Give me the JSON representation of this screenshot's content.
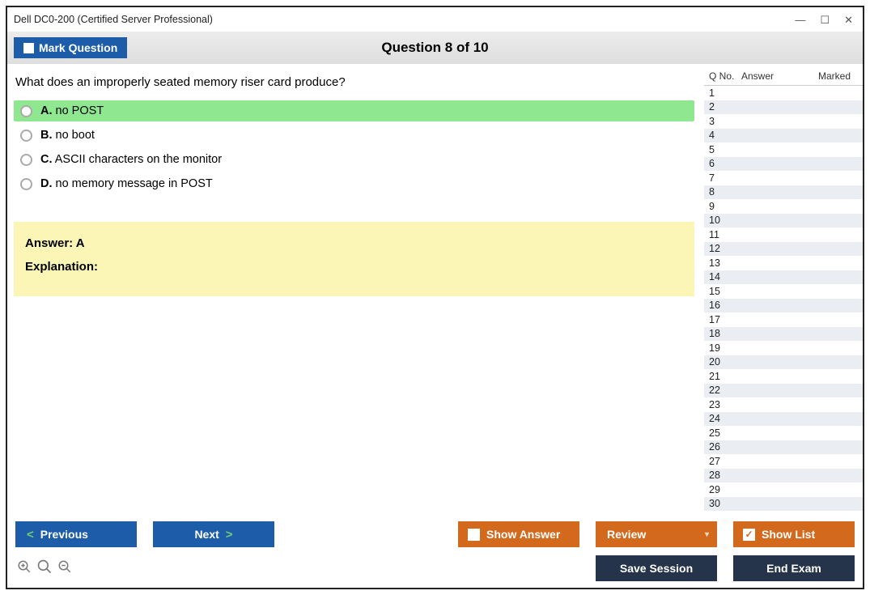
{
  "window": {
    "title": "Dell DC0-200 (Certified Server Professional)"
  },
  "toolbar": {
    "mark_label": "Mark Question",
    "counter": "Question 8 of 10"
  },
  "question": {
    "text": "What does an improperly seated memory riser card produce?",
    "options": [
      {
        "letter": "A.",
        "text": "no POST",
        "highlight": true
      },
      {
        "letter": "B.",
        "text": "no boot",
        "highlight": false
      },
      {
        "letter": "C.",
        "text": "ASCII characters on the monitor",
        "highlight": false
      },
      {
        "letter": "D.",
        "text": "no memory message in POST",
        "highlight": false
      }
    ],
    "answer_label": "Answer: ",
    "answer_value": "A",
    "explanation_label": "Explanation:"
  },
  "sidebar": {
    "h_qno": "Q No.",
    "h_answer": "Answer",
    "h_marked": "Marked",
    "rows": [
      {
        "n": "1"
      },
      {
        "n": "2"
      },
      {
        "n": "3"
      },
      {
        "n": "4"
      },
      {
        "n": "5"
      },
      {
        "n": "6"
      },
      {
        "n": "7"
      },
      {
        "n": "8"
      },
      {
        "n": "9"
      },
      {
        "n": "10"
      },
      {
        "n": "11"
      },
      {
        "n": "12"
      },
      {
        "n": "13"
      },
      {
        "n": "14"
      },
      {
        "n": "15"
      },
      {
        "n": "16"
      },
      {
        "n": "17"
      },
      {
        "n": "18"
      },
      {
        "n": "19"
      },
      {
        "n": "20"
      },
      {
        "n": "21"
      },
      {
        "n": "22"
      },
      {
        "n": "23"
      },
      {
        "n": "24"
      },
      {
        "n": "25"
      },
      {
        "n": "26"
      },
      {
        "n": "27"
      },
      {
        "n": "28"
      },
      {
        "n": "29"
      },
      {
        "n": "30"
      }
    ]
  },
  "footer": {
    "previous": "Previous",
    "next": "Next",
    "show_answer": "Show Answer",
    "review": "Review",
    "show_list": "Show List",
    "save_session": "Save Session",
    "end_exam": "End Exam"
  },
  "icons": {
    "zoom_reset": "⊕",
    "zoom_in": "🔍",
    "zoom_out": "⊖"
  }
}
